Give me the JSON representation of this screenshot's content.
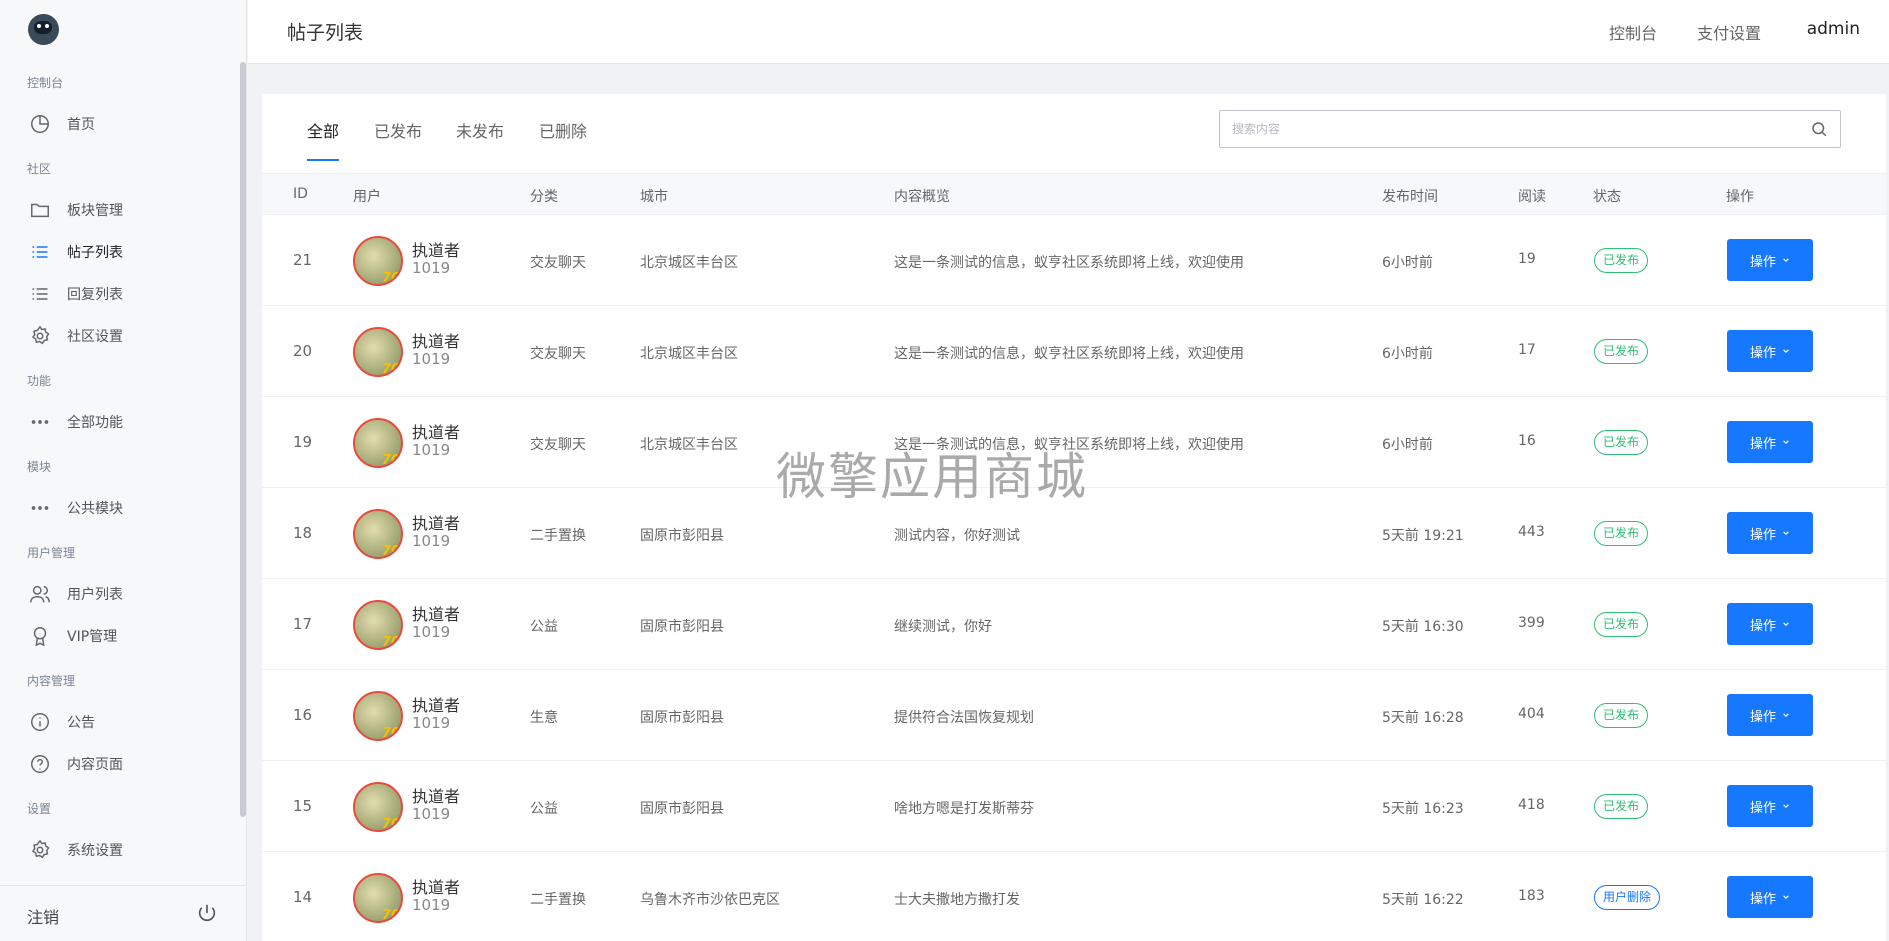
{
  "sidebar": {
    "sections": [
      {
        "title": "控制台",
        "items": [
          {
            "label": "首页",
            "icon": "pie-chart-icon"
          }
        ]
      },
      {
        "title": "社区",
        "items": [
          {
            "label": "板块管理",
            "icon": "folder-icon"
          },
          {
            "label": "帖子列表",
            "icon": "list-icon",
            "active": true
          },
          {
            "label": "回复列表",
            "icon": "list-icon"
          },
          {
            "label": "社区设置",
            "icon": "gear-icon"
          }
        ]
      },
      {
        "title": "功能",
        "items": [
          {
            "label": "全部功能",
            "icon": "more-icon"
          }
        ]
      },
      {
        "title": "模块",
        "items": [
          {
            "label": "公共模块",
            "icon": "more-icon"
          }
        ]
      },
      {
        "title": "用户管理",
        "items": [
          {
            "label": "用户列表",
            "icon": "users-icon"
          },
          {
            "label": "VIP管理",
            "icon": "award-icon"
          }
        ]
      },
      {
        "title": "内容管理",
        "items": [
          {
            "label": "公告",
            "icon": "info-icon"
          },
          {
            "label": "内容页面",
            "icon": "question-icon"
          }
        ]
      },
      {
        "title": "设置",
        "items": [
          {
            "label": "系统设置",
            "icon": "gear-icon"
          }
        ]
      }
    ],
    "logout_label": "注销"
  },
  "header": {
    "title": "帖子列表",
    "links": [
      "控制台",
      "支付设置"
    ],
    "user": "admin"
  },
  "tabs": [
    "全部",
    "已发布",
    "未发布",
    "已删除"
  ],
  "search": {
    "placeholder": "搜索内容"
  },
  "table": {
    "columns": [
      "ID",
      "用户",
      "分类",
      "城市",
      "内容概览",
      "发布时间",
      "阅读",
      "状态",
      "操作"
    ],
    "rows": [
      {
        "id": "21",
        "user": "执道者",
        "uid": "1019",
        "category": "交友聊天",
        "city": "北京城区丰台区",
        "content": "这是一条测试的信息，蚁亨社区系统即将上线，欢迎使用",
        "time": "6小时前",
        "reads": "19",
        "status": "已发布",
        "status_color": "#2fbf71",
        "action": "操作"
      },
      {
        "id": "20",
        "user": "执道者",
        "uid": "1019",
        "category": "交友聊天",
        "city": "北京城区丰台区",
        "content": "这是一条测试的信息，蚁亨社区系统即将上线，欢迎使用",
        "time": "6小时前",
        "reads": "17",
        "status": "已发布",
        "status_color": "#2fbf71",
        "action": "操作"
      },
      {
        "id": "19",
        "user": "执道者",
        "uid": "1019",
        "category": "交友聊天",
        "city": "北京城区丰台区",
        "content": "这是一条测试的信息，蚁亨社区系统即将上线，欢迎使用",
        "time": "6小时前",
        "reads": "16",
        "status": "已发布",
        "status_color": "#2fbf71",
        "action": "操作"
      },
      {
        "id": "18",
        "user": "执道者",
        "uid": "1019",
        "category": "二手置换",
        "city": "固原市彭阳县",
        "content": "测试内容，你好测试",
        "time": "5天前 19:21",
        "reads": "443",
        "status": "已发布",
        "status_color": "#2fbf71",
        "action": "操作"
      },
      {
        "id": "17",
        "user": "执道者",
        "uid": "1019",
        "category": "公益",
        "city": "固原市彭阳县",
        "content": "继续测试，你好",
        "time": "5天前 16:30",
        "reads": "399",
        "status": "已发布",
        "status_color": "#2fbf71",
        "action": "操作"
      },
      {
        "id": "16",
        "user": "执道者",
        "uid": "1019",
        "category": "生意",
        "city": "固原市彭阳县",
        "content": "提供符合法国恢复规划",
        "time": "5天前 16:28",
        "reads": "404",
        "status": "已发布",
        "status_color": "#2fbf71",
        "action": "操作"
      },
      {
        "id": "15",
        "user": "执道者",
        "uid": "1019",
        "category": "公益",
        "city": "固原市彭阳县",
        "content": "啥地方嗯是打发斯蒂芬",
        "time": "5天前 16:23",
        "reads": "418",
        "status": "已发布",
        "status_color": "#2fbf71",
        "action": "操作"
      },
      {
        "id": "14",
        "user": "执道者",
        "uid": "1019",
        "category": "二手置换",
        "city": "乌鲁木齐市沙依巴克区",
        "content": "士大夫撒地方撒打发",
        "time": "5天前 16:22",
        "reads": "183",
        "status": "用户删除",
        "status_color": "#1677ff",
        "action": "操作"
      }
    ]
  },
  "watermark": "微擎应用商城",
  "colors": {
    "accent": "#1677ff",
    "published": "#2fbf71",
    "avatar_border": "#e84b3c"
  }
}
